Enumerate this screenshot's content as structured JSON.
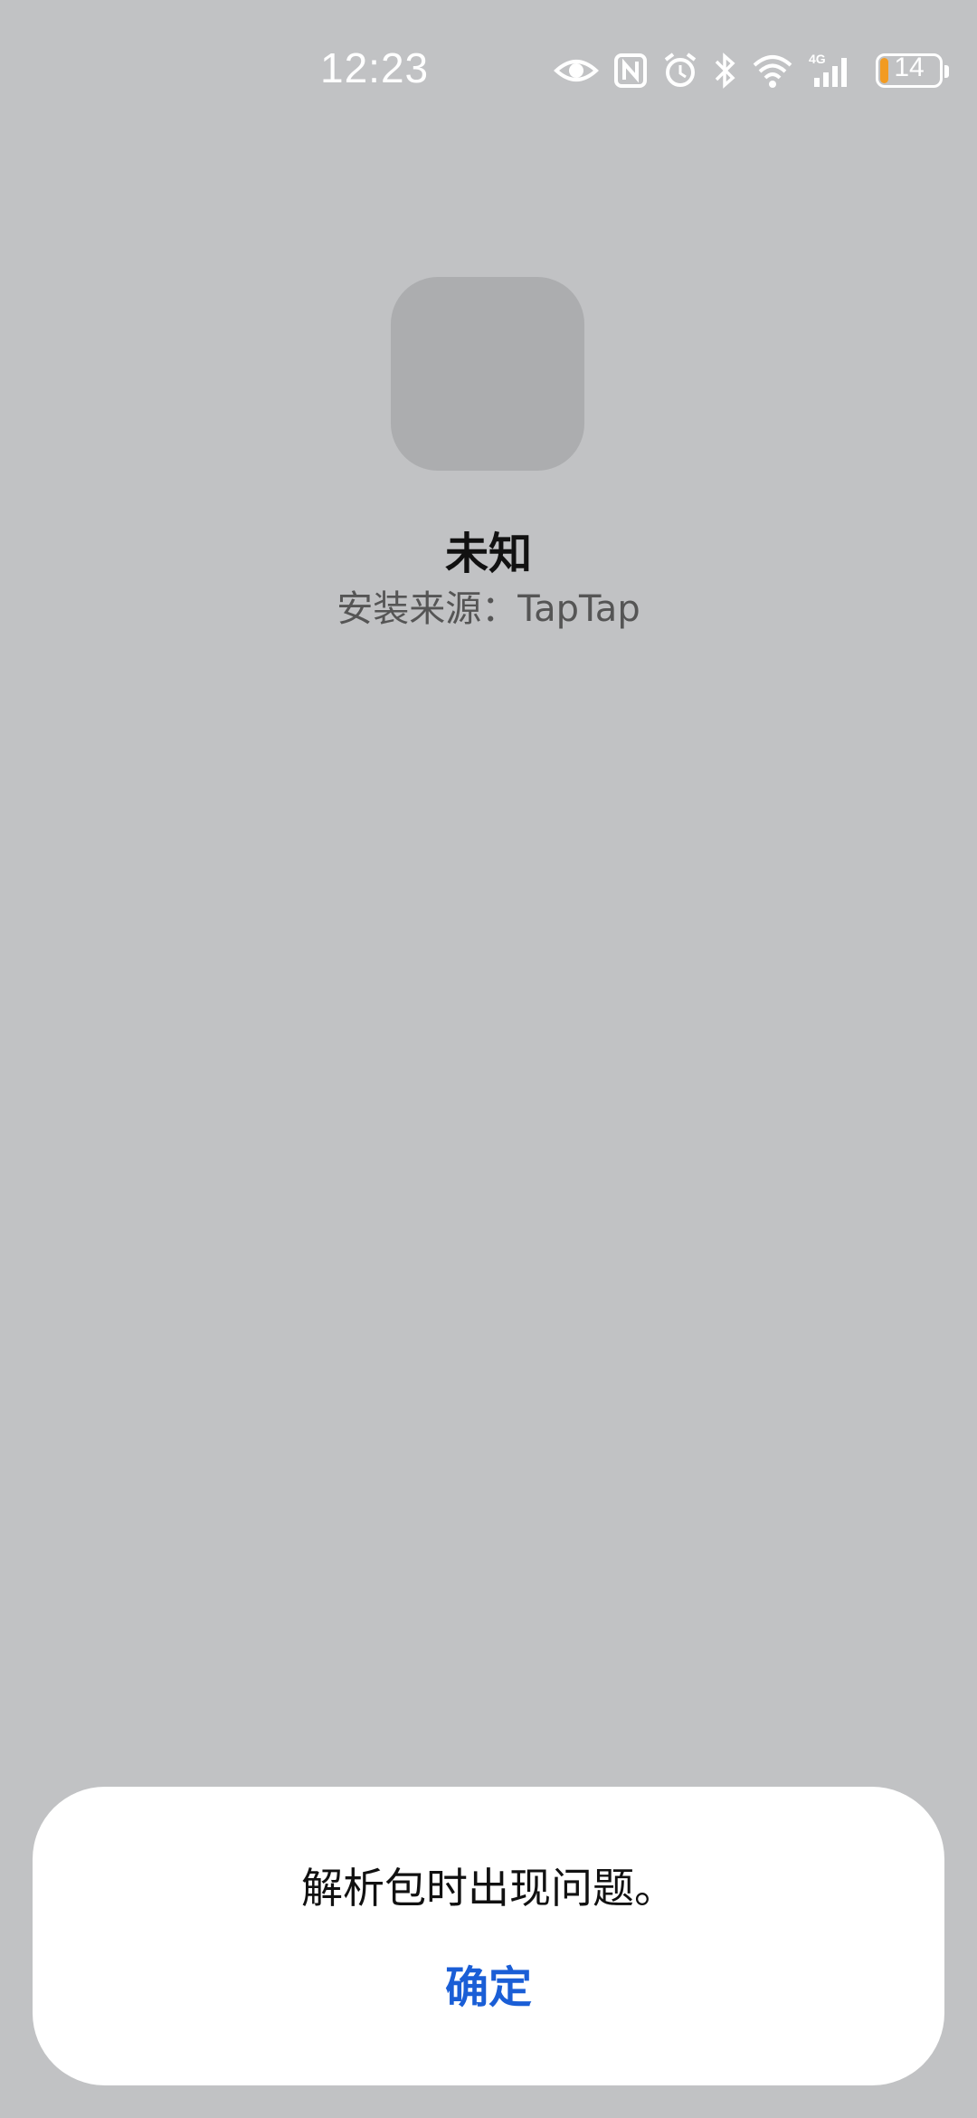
{
  "status_bar": {
    "time": "12:23",
    "battery_level": "14",
    "battery_fraction": 0.14,
    "battery_color": "#f29b22",
    "network_label": "4G",
    "icons": [
      "eye-icon",
      "nfc-icon",
      "alarm-icon",
      "bluetooth-icon",
      "wifi-icon",
      "cellular-signal-icon",
      "battery-icon"
    ]
  },
  "app": {
    "name": "未知",
    "source": "安装来源：TapTap"
  },
  "dialog": {
    "message": "解析包时出现问题。",
    "confirm_label": "确定",
    "confirm_color": "#1a5ed6"
  }
}
